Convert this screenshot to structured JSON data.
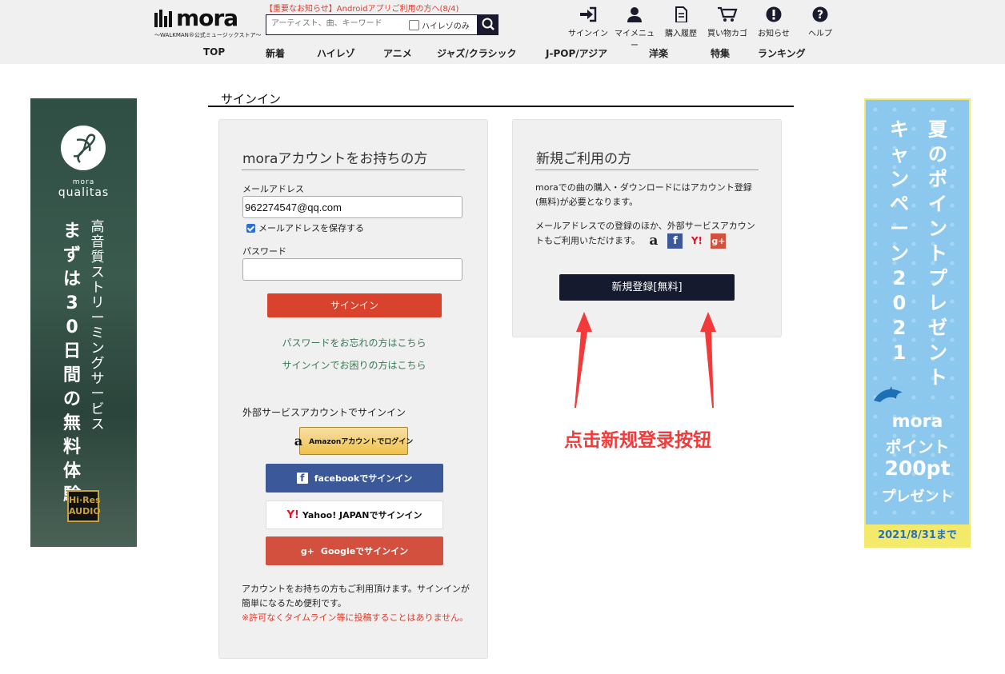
{
  "header": {
    "logo_text": "mora",
    "logo_sub": "〜WALKMAN®公式ミュージックストア〜",
    "notice": "【重要なお知らせ】Androidアプリご利用の方へ(8/4)",
    "search_placeholder": "アーティスト、曲、キーワード",
    "hires_only_label": "ハイレゾのみ",
    "icons": [
      {
        "name": "signin-icon",
        "label": "サインイン"
      },
      {
        "name": "mymenu-icon",
        "label": "マイメニュー"
      },
      {
        "name": "history-icon",
        "label": "購入履歴"
      },
      {
        "name": "cart-icon",
        "label": "買い物カゴ"
      },
      {
        "name": "info-icon",
        "label": "お知らせ"
      },
      {
        "name": "help-icon",
        "label": "ヘルプ"
      }
    ],
    "nav": [
      "TOP",
      "新着",
      "ハイレゾ",
      "アニメ",
      "ジャズ/クラシック",
      "J-POP/アジア",
      "洋楽",
      "特集",
      "ランキング"
    ]
  },
  "page_title": "サインイン",
  "login_panel": {
    "heading": "moraアカウントをお持ちの方",
    "email_label": "メールアドレス",
    "email_value": "962274547@qq.com",
    "remember_label": "メールアドレスを保存する",
    "password_label": "パスワード",
    "signin_button": "サインイン",
    "forgot_link": "パスワードをお忘れの方はこちら",
    "trouble_link": "サインインでお困りの方はこちら",
    "external_heading": "外部サービスアカウントでサインイン",
    "amazon_button": "Amazonアカウントでログイン",
    "facebook_button": "facebookでサインイン",
    "yahoo_button": "Yahoo! JAPANでサインイン",
    "google_button": "Googleでサインイン",
    "note": "アカウントをお持ちの方もご利用頂けます。サインインが簡単になるため便利です。",
    "note_red": "※許可なくタイムライン等に投稿することはありません。"
  },
  "register_panel": {
    "heading": "新規ご利用の方",
    "text1": "moraでの曲の購入・ダウンロードにはアカウント登録(無料)が必要となります。",
    "text2": "メールアドレスでの登録のほか、外部サービスアカウントもご利用いただけます。",
    "register_button": "新規登録[無料]"
  },
  "annotation": {
    "caption": "点击新规登录按钮",
    "color": "#f23a3a"
  },
  "ad_left": {
    "brand_small": "mora",
    "brand": "qualitas",
    "line1": "高音質ストリーミングサービス",
    "line2": "まずは30日間の無料体験",
    "badge": "Hi·Res AUDIO"
  },
  "ad_right": {
    "col1": "夏のポイントプレゼント",
    "col2": "キャンペーン2021",
    "pt_brand": "mora",
    "pt_label": "ポイント",
    "pt_value": "200pt",
    "pt_action": "プレゼント",
    "deadline": "2021/8/31まで"
  }
}
